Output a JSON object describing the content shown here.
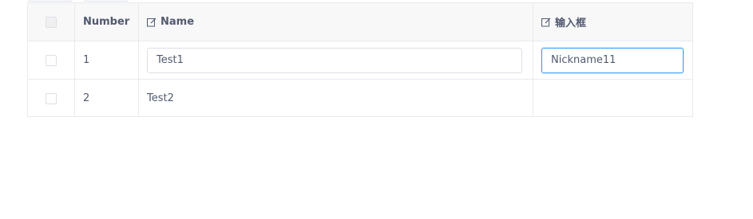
{
  "table": {
    "headers": {
      "number": "Number",
      "name": "Name",
      "input": "输入框"
    },
    "rows": [
      {
        "number": "1",
        "name": "Test1",
        "input": "Nickname11"
      },
      {
        "number": "2",
        "name": "Test2",
        "input": ""
      }
    ]
  },
  "colors": {
    "accent": "#409eff",
    "border": "#e8eaec",
    "header_bg": "#f8f8f9"
  }
}
